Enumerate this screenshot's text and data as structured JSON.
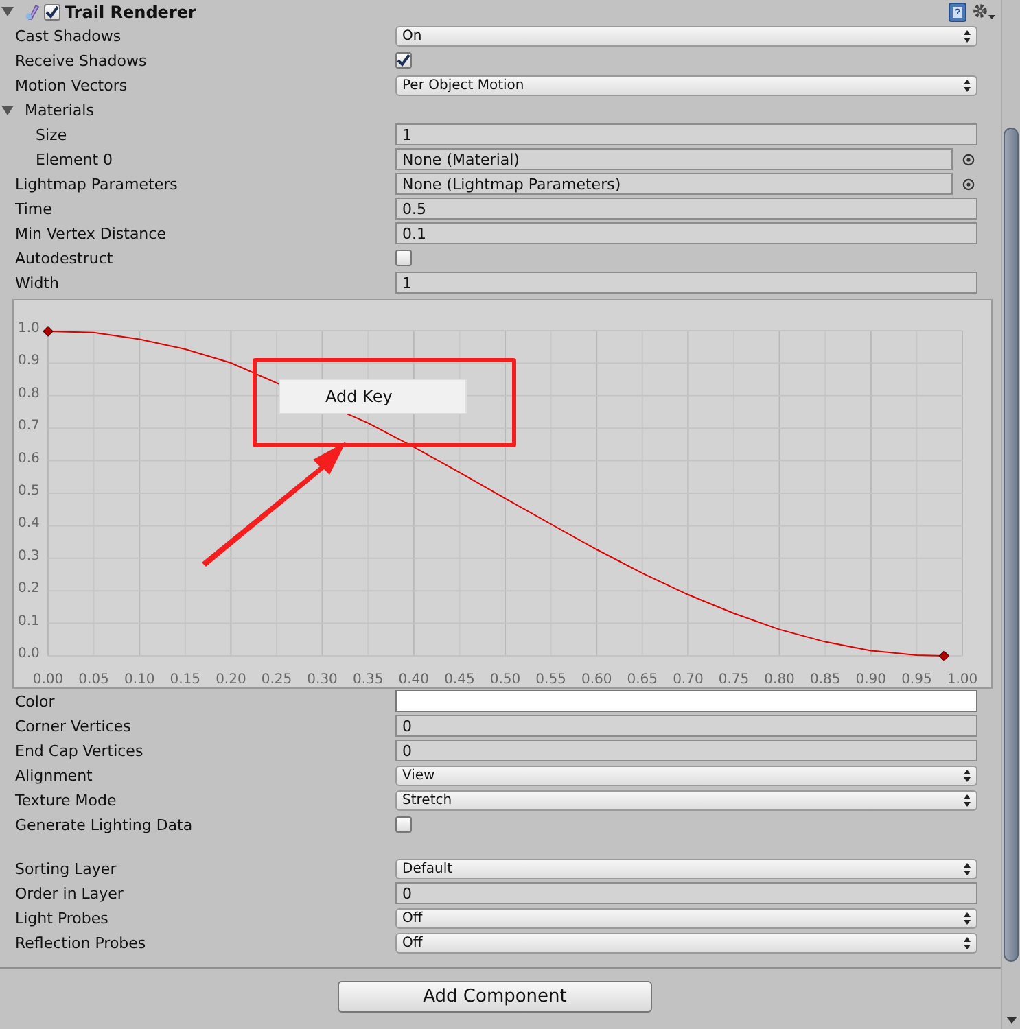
{
  "component": {
    "title": "Trail Renderer",
    "enabled": true,
    "expanded": true
  },
  "rows": [
    {
      "kind": "dropdown",
      "label": "Cast Shadows",
      "value": "On"
    },
    {
      "kind": "checkbox",
      "label": "Receive Shadows",
      "checked": true
    },
    {
      "kind": "dropdown",
      "label": "Motion Vectors",
      "value": "Per Object Motion"
    },
    {
      "kind": "foldout",
      "label": "Materials",
      "expanded": true,
      "children": [
        {
          "kind": "field",
          "label": "Size",
          "value": "1"
        },
        {
          "kind": "object",
          "label": "Element 0",
          "value": "None (Material)"
        }
      ]
    },
    {
      "kind": "object",
      "label": "Lightmap Parameters",
      "value": "None (Lightmap Parameters)"
    },
    {
      "kind": "field",
      "label": "Time",
      "value": "0.5"
    },
    {
      "kind": "field",
      "label": "Min Vertex Distance",
      "value": "0.1"
    },
    {
      "kind": "checkbox",
      "label": "Autodestruct",
      "checked": false
    },
    {
      "kind": "field",
      "label": "Width",
      "value": "1"
    },
    {
      "kind": "curve",
      "context_menu": {
        "items": [
          "Add Key"
        ]
      },
      "chart_data": {
        "type": "line",
        "x": [
          0,
          0.05,
          0.1,
          0.15,
          0.2,
          0.35,
          0.4,
          0.45,
          0.5,
          0.55,
          0.6,
          0.65,
          0.7,
          0.75,
          0.8,
          0.85,
          0.9,
          0.95,
          0.98
        ],
        "grid": true,
        "series": [
          {
            "color": "#e00000",
            "values": [
              0.998,
              0.994,
              0.974,
              0.943,
              0.901,
              0.716,
              0.642,
              0.564,
              0.484,
              0.405,
              0.327,
              0.254,
              0.188,
              0.131,
              0.081,
              0.043,
              0.016,
              0.002,
              0
            ]
          }
        ],
        "xlim": [
          0,
          1
        ],
        "ylim": [
          0,
          1
        ],
        "xticks": [
          {
            "value": 0,
            "label": "0.00"
          },
          {
            "value": 0.05,
            "label": "0.05"
          },
          {
            "value": 0.1,
            "label": "0.10"
          },
          {
            "value": 0.15,
            "label": "0.15"
          },
          {
            "value": 0.2,
            "label": "0.20"
          },
          {
            "value": 0.25,
            "label": "0.25"
          },
          {
            "value": 0.3,
            "label": "0.30"
          },
          {
            "value": 0.35,
            "label": "0.35"
          },
          {
            "value": 0.4,
            "label": "0.40"
          },
          {
            "value": 0.45,
            "label": "0.45"
          },
          {
            "value": 0.5,
            "label": "0.50"
          },
          {
            "value": 0.55,
            "label": "0.55"
          },
          {
            "value": 0.6,
            "label": "0.60"
          },
          {
            "value": 0.65,
            "label": "0.65"
          },
          {
            "value": 0.7,
            "label": "0.70"
          },
          {
            "value": 0.75,
            "label": "0.75"
          },
          {
            "value": 0.8,
            "label": "0.80"
          },
          {
            "value": 0.85,
            "label": "0.85"
          },
          {
            "value": 0.9,
            "label": "0.90"
          },
          {
            "value": 0.95,
            "label": "0.95"
          },
          {
            "value": 1,
            "label": "1.00"
          }
        ],
        "yticks": [
          {
            "value": 1,
            "label": "1.0"
          },
          {
            "value": 0.9,
            "label": "0.9"
          },
          {
            "value": 0.8,
            "label": "0.8"
          },
          {
            "value": 0.7,
            "label": "0.7"
          },
          {
            "value": 0.6,
            "label": "0.6"
          },
          {
            "value": 0.5,
            "label": "0.5"
          },
          {
            "value": 0.4,
            "label": "0.4"
          },
          {
            "value": 0.3,
            "label": "0.3"
          },
          {
            "value": 0.2,
            "label": "0.2"
          },
          {
            "value": 0.1,
            "label": "0.1"
          },
          {
            "value": 0,
            "label": "0.0"
          }
        ]
      }
    },
    {
      "kind": "color",
      "label": "Color",
      "color": "#ffffff"
    },
    {
      "kind": "field",
      "label": "Corner Vertices",
      "value": "0"
    },
    {
      "kind": "field",
      "label": "End Cap Vertices",
      "value": "0"
    },
    {
      "kind": "dropdown",
      "label": "Alignment",
      "value": "View"
    },
    {
      "kind": "dropdown",
      "label": "Texture Mode",
      "value": "Stretch"
    },
    {
      "kind": "checkbox",
      "label": "Generate Lighting Data",
      "checked": false
    },
    {
      "kind": "gap"
    },
    {
      "kind": "dropdown",
      "label": "Sorting Layer",
      "value": "Default"
    },
    {
      "kind": "field",
      "label": "Order in Layer",
      "value": "0"
    },
    {
      "kind": "dropdown",
      "label": "Light Probes",
      "value": "Off"
    },
    {
      "kind": "dropdown",
      "label": "Reflection Probes",
      "value": "Off"
    }
  ],
  "add_component_button": "Add Component"
}
